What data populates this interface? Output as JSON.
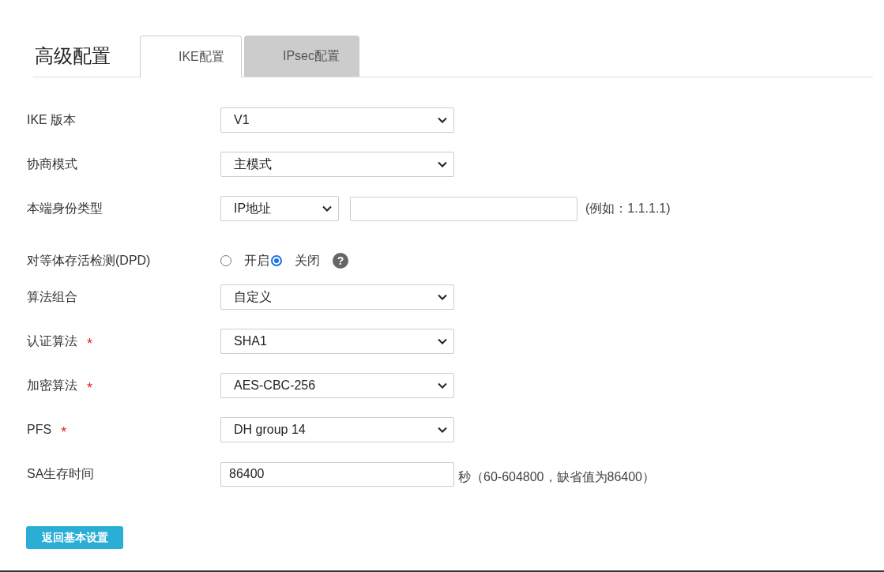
{
  "header": {
    "title": "高级配置"
  },
  "tabs": [
    {
      "label": "IKE配置",
      "selected": true
    },
    {
      "label": "IPsec配置",
      "selected": false
    }
  ],
  "form": [
    {
      "kind": "select",
      "label": "IKE 版本",
      "required": false,
      "value": "V1"
    },
    {
      "kind": "select",
      "label": "协商模式",
      "required": false,
      "value": "主模式"
    },
    {
      "kind": "select_input",
      "label": "本端身份类型",
      "required": false,
      "value": "IP地址",
      "hint": "(例如：1.1.1.1)"
    },
    {
      "kind": "radio",
      "label": "对等体存活检测(DPD)",
      "required": false,
      "options": [
        {
          "label": "开启",
          "selected": false
        },
        {
          "label": "关闭",
          "selected": true
        }
      ],
      "help": "?"
    },
    {
      "kind": "select",
      "label": "算法组合",
      "required": false,
      "value": "自定义"
    },
    {
      "kind": "select",
      "label": "认证算法",
      "required": true,
      "value": "SHA1"
    },
    {
      "kind": "select",
      "label": "加密算法",
      "required": true,
      "value": "AES-CBC-256"
    },
    {
      "kind": "select",
      "label": "PFS",
      "required": true,
      "value": "DH group 14"
    },
    {
      "kind": "input",
      "label": "SA生存时间",
      "required": false,
      "value": "86400",
      "hint": "秒（60-604800，缺省值为86400）"
    }
  ],
  "required_mark": "*",
  "button": {
    "label": "返回基本设置"
  }
}
